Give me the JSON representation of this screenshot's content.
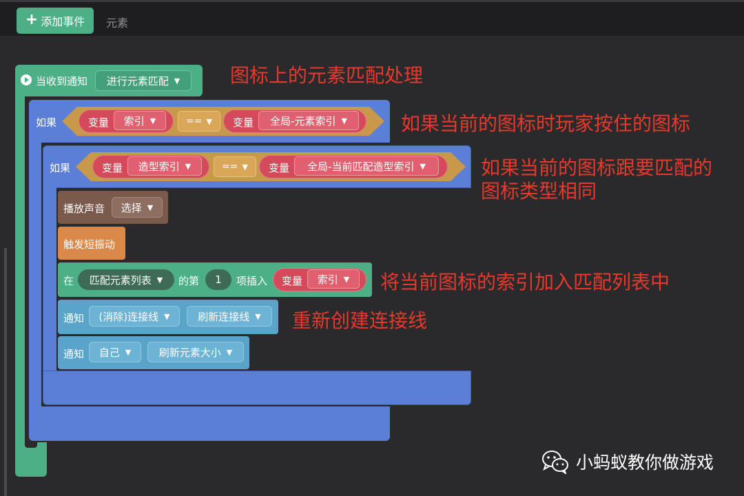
{
  "toolbar": {
    "add_event_label": "添加事件",
    "tab_elements": "元素"
  },
  "event_block": {
    "label": "当收到通知",
    "message": "进行元素匹配"
  },
  "if_outer": {
    "label": "如果",
    "var_label_a": "变量",
    "var_value_a": "索引",
    "operator": "==",
    "var_label_b": "变量",
    "var_value_b": "全局-元素索引"
  },
  "if_inner": {
    "label": "如果",
    "var_label_a": "变量",
    "var_value_a": "造型索引",
    "operator": "==",
    "var_label_b": "变量",
    "var_value_b": "全局-当前匹配造型索引"
  },
  "actions": {
    "play_sound_label": "播放声音",
    "play_sound_value": "选择",
    "vibrate_label": "触发短振动",
    "insert_prefix": "在",
    "insert_list": "匹配元素列表",
    "insert_mid": "的第",
    "insert_index": "1",
    "insert_suffix": "项插入",
    "insert_var_label": "变量",
    "insert_var_value": "索引",
    "notify1_label": "通知",
    "notify1_target": "(消除)连接线",
    "notify1_message": "刷新连接线",
    "notify2_label": "通知",
    "notify2_target": "自己",
    "notify2_message": "刷新元素大小"
  },
  "annotations": {
    "a1": "图标上的元素匹配处理",
    "a2": "如果当前的图标时玩家按住的图标",
    "a3_line1": "如果当前的图标跟要匹配的",
    "a3_line2": "图标类型相同",
    "a4": "将当前图标的索引加入匹配列表中",
    "a5": "重新创建连接线"
  },
  "watermark": "小蚂蚁教你做游戏",
  "colors": {
    "event_green": "#4caf86",
    "if_blue": "#5b7fd6",
    "condition_gold": "#c8994a",
    "variable_red": "#d54a5a",
    "sound_brown": "#7a5a4b",
    "vibrate_orange": "#d9894a",
    "notify_lightblue": "#5aa4c9",
    "annotation_red": "#e8382c"
  },
  "icons": {
    "add": "plus-icon",
    "event": "play-circle-icon",
    "dropdown": "triangle-down-icon",
    "watermark": "wechat-icon"
  }
}
